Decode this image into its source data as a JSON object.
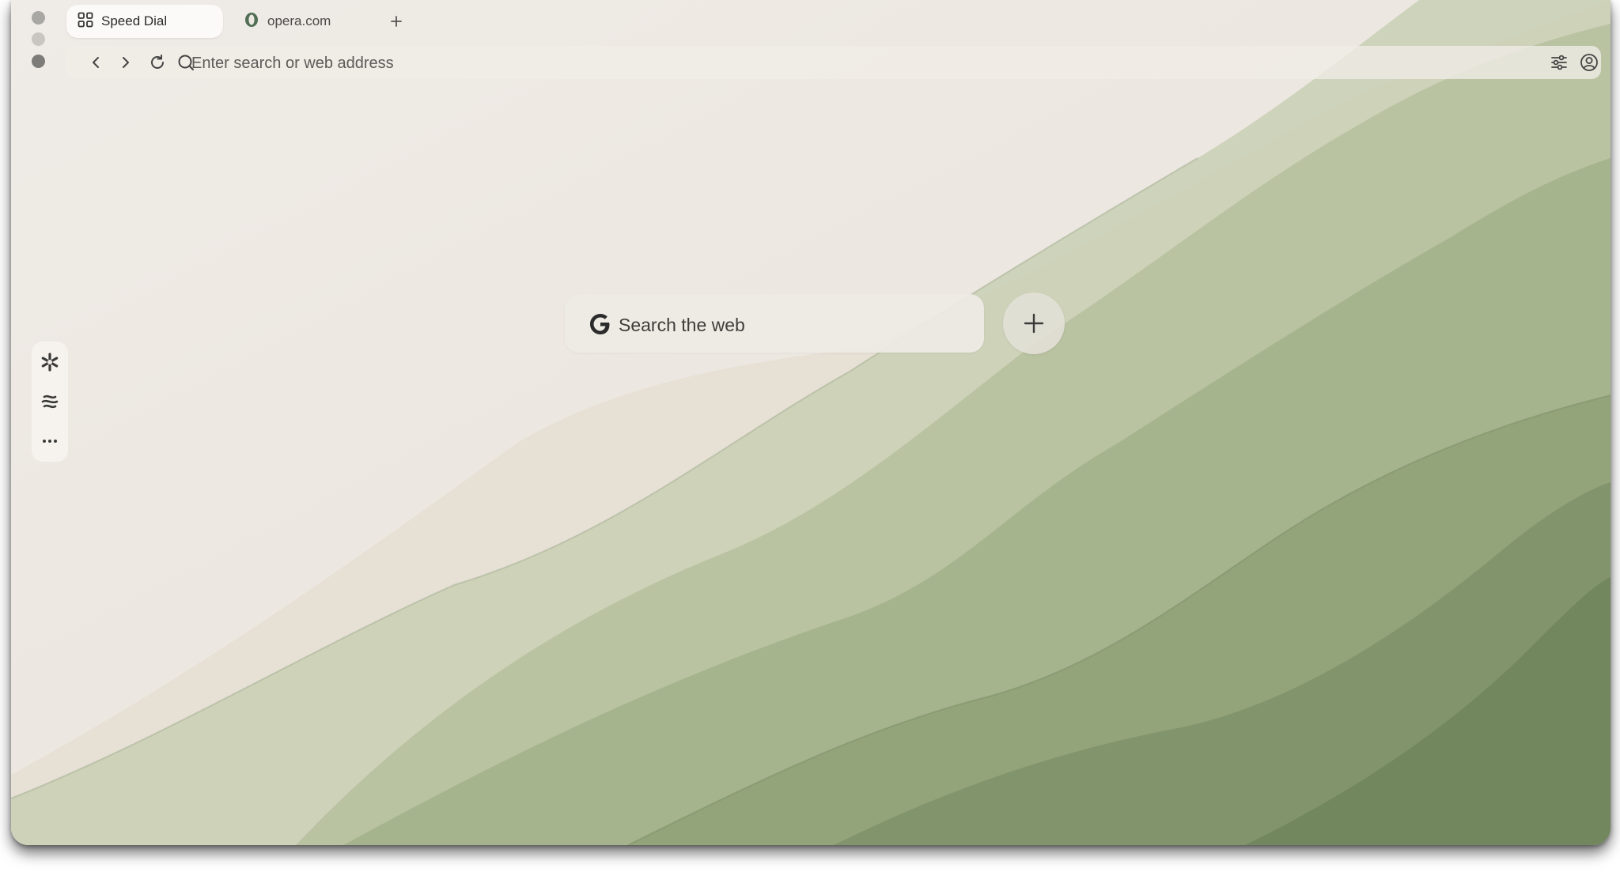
{
  "window": {
    "tabs": [
      {
        "label": "Speed Dial",
        "icon": "grid-icon",
        "active": true
      },
      {
        "label": "opera.com",
        "icon": "opera-logo-icon",
        "active": false
      }
    ],
    "new_tab_icon": "plus-icon"
  },
  "address_bar": {
    "placeholder": "Enter search or web address",
    "value": "",
    "icons": [
      "back-icon",
      "forward-icon",
      "reload-icon",
      "search-icon",
      "easy-setup-icon",
      "profile-icon"
    ]
  },
  "sidebar": {
    "items": [
      {
        "name": "aria-icon"
      },
      {
        "name": "flow-icon"
      },
      {
        "name": "more-icon"
      }
    ]
  },
  "speed_dial": {
    "search": {
      "engine_icon": "google-icon",
      "placeholder": "Search the web"
    },
    "add_icon": "plus-icon"
  },
  "colors": {
    "background": "#ede8e1",
    "green_light": "#b7c2a1",
    "green_mid": "#9aab86",
    "green_dark": "#7a8f68",
    "google_g": "#2b2b2b"
  }
}
